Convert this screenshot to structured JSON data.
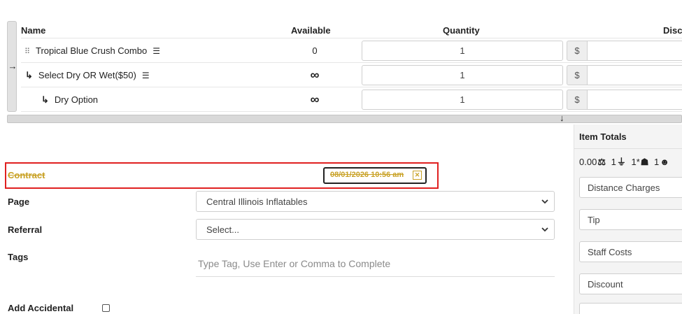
{
  "items_table": {
    "headers": {
      "name": "Name",
      "available": "Available",
      "quantity": "Quantity",
      "discount": "Disco"
    },
    "rows": [
      {
        "name": "Tropical Blue Crush Combo",
        "available": "0",
        "quantity": "1",
        "currency": "$"
      },
      {
        "name": "Select Dry OR Wet($50)",
        "available": "∞",
        "quantity": "1",
        "currency": "$"
      },
      {
        "name": "Dry Option",
        "available": "∞",
        "quantity": "1",
        "currency": "$"
      }
    ]
  },
  "contract": {
    "label": "Contract",
    "date": "08/01/2026 10:56 am"
  },
  "form": {
    "page_label": "Page",
    "page_value": "Central Illinois Inflatables",
    "referral_label": "Referral",
    "referral_value": "Select...",
    "tags_label": "Tags",
    "tags_placeholder": "Type Tag, Use Enter or Comma to Complete",
    "accidental_label": "Add Accidental"
  },
  "totals": {
    "title": "Item Totals",
    "weight": "0.00",
    "power": "1",
    "staff": "1*",
    "people": "1",
    "fields": [
      "Distance Charges",
      "Tip",
      "Staff Costs",
      "Discount"
    ]
  },
  "colors": {
    "accent_gold": "#c9a227",
    "highlight_red": "#e02020"
  }
}
